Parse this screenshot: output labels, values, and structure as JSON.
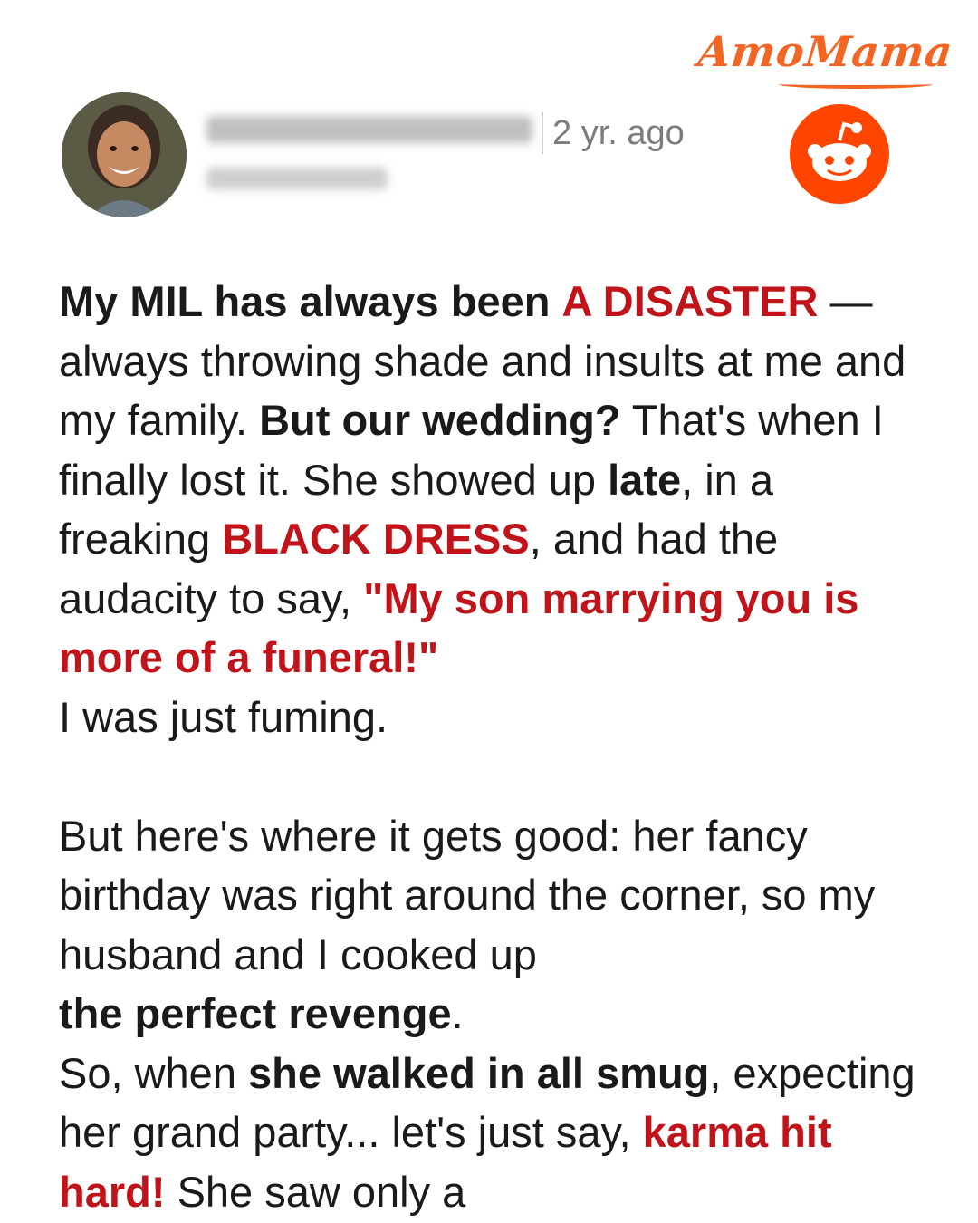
{
  "brand": {
    "logo_text": "AmoMama",
    "accent_color": "#f26522"
  },
  "header": {
    "timestamp": "2 yr. ago",
    "avatar": "user-avatar-photo",
    "platform_icon": "reddit-icon",
    "username_blurred": true
  },
  "colors": {
    "highlight": "#c0141a",
    "text": "#1a1a1a",
    "muted": "#7c7c7c"
  },
  "post": {
    "p1": {
      "s1": "My MIL has always been",
      "s2": "A DISASTER",
      "s3": "—always throwing shade and insults at me and my family.",
      "s4": "But our wedding?",
      "s5": "That's when I finally lost it. She showed up",
      "s6": "late",
      "s7": ", in a freaking",
      "s8": "BLACK DRESS",
      "s9": ", and had the audacity to say,",
      "s10": "\"My son marrying you is more of a funeral!\"",
      "s11": "I was just fuming."
    },
    "p2": {
      "s1": "But here's where it gets good: her fancy birthday was right around the corner, so my husband and I cooked up",
      "s2": "the perfect revenge",
      "s3": ".",
      "s4": "So, when",
      "s5": "she walked in all smug",
      "s6": ", expecting her grand party... let's just say,",
      "s7": "karma hit hard!",
      "s8": "She saw only a"
    }
  }
}
